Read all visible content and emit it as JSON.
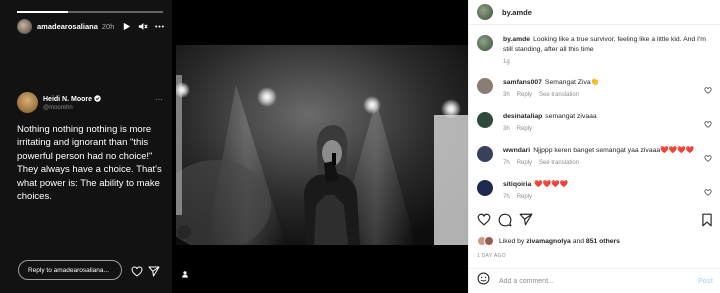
{
  "story": {
    "progress": 0.35,
    "username": "amadearosaliana",
    "time": "20h",
    "tweet": {
      "name": "Heidi N. Moore",
      "handle": "@moorehn",
      "text": "Nothing nothing nothing is more irritating and ignorant than \"this powerful person had no choice!\" They always have a choice. That's what power is: The ability to make choices."
    },
    "reply_placeholder": "Reply to amadearosaliana..."
  },
  "post": {
    "username": "by.amde",
    "caption_user": "by.amde",
    "caption": "Looking like a true survivor, feeling like a little kid. And I'm still standing, after all this time",
    "caption_time": "1g",
    "comments": [
      {
        "user": "samfans007",
        "text": "Semangat Ziva👏",
        "time": "3h",
        "reply": "Reply",
        "translate": "See translation",
        "avatar": "#8a7d74"
      },
      {
        "user": "desinataliap",
        "text": "semangat zivaaa",
        "time": "3h",
        "reply": "Reply",
        "translate": "",
        "avatar": "#2e4a3b"
      },
      {
        "user": "wwndari",
        "text": "Njjppp keren banget semangat yaa zivaaa❤️❤️❤️❤️",
        "time": "7h",
        "reply": "Reply",
        "translate": "See translation",
        "avatar": "#39405a"
      },
      {
        "user": "sitiqoiria",
        "text": "❤️❤️❤️❤️",
        "time": "7h",
        "reply": "Reply",
        "translate": "",
        "avatar": "#1d2a4d"
      }
    ],
    "likes_prefix": "Liked by",
    "likes_user": "zivamagnolya",
    "likes_and": "and",
    "likes_others": "851 others",
    "date": "1 DAY AGO",
    "comment_placeholder": "Add a comment...",
    "post_label": "Post"
  }
}
